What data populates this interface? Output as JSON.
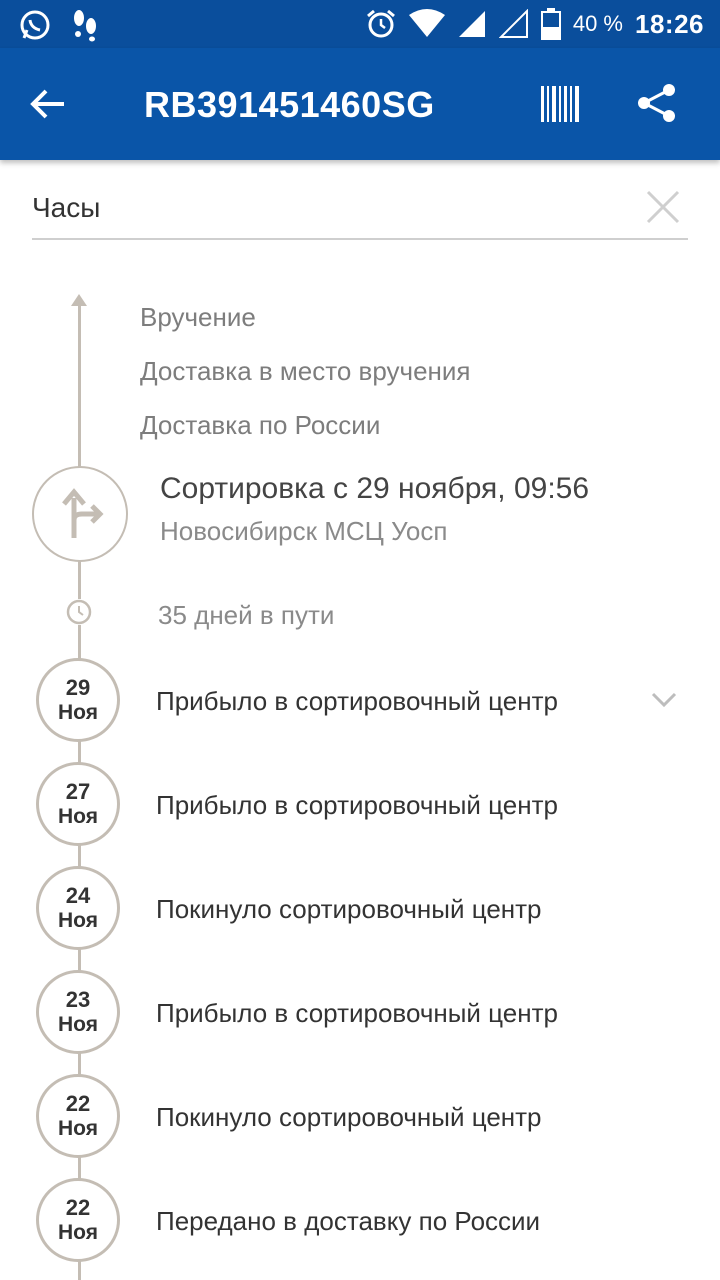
{
  "status_bar": {
    "battery": "40 %",
    "time": "18:26",
    "icons": [
      "whatsapp-icon",
      "footsteps-icon",
      "alarm-icon",
      "wifi-icon",
      "signal-icon",
      "signal-empty-icon",
      "battery-icon"
    ]
  },
  "toolbar": {
    "title": "RB391451460SG",
    "icons": [
      "back-arrow-icon",
      "barcode-icon",
      "share-icon"
    ]
  },
  "search": {
    "value": "Часы"
  },
  "future_steps": [
    "Вручение",
    "Доставка в место вручения",
    "Доставка по России"
  ],
  "current": {
    "title": "Сортировка с 29 ноября, 09:56",
    "subtitle": "Новосибирск МСЦ Уосп"
  },
  "transit": "35 дней в пути",
  "events": [
    {
      "day": "29",
      "month": "Ноя",
      "text": "Прибыло в сортировочный центр"
    },
    {
      "day": "27",
      "month": "Ноя",
      "text": "Прибыло в сортировочный центр"
    },
    {
      "day": "24",
      "month": "Ноя",
      "text": "Покинуло сортировочный центр"
    },
    {
      "day": "23",
      "month": "Ноя",
      "text": "Прибыло в сортировочный центр"
    },
    {
      "day": "22",
      "month": "Ноя",
      "text": "Покинуло сортировочный центр"
    },
    {
      "day": "22",
      "month": "Ноя",
      "text": "Передано в доставку по России"
    }
  ],
  "colors": {
    "toolbar": "#0a55a8",
    "status_bar": "#0a4e9c",
    "timeline": "#c4bdb4"
  }
}
